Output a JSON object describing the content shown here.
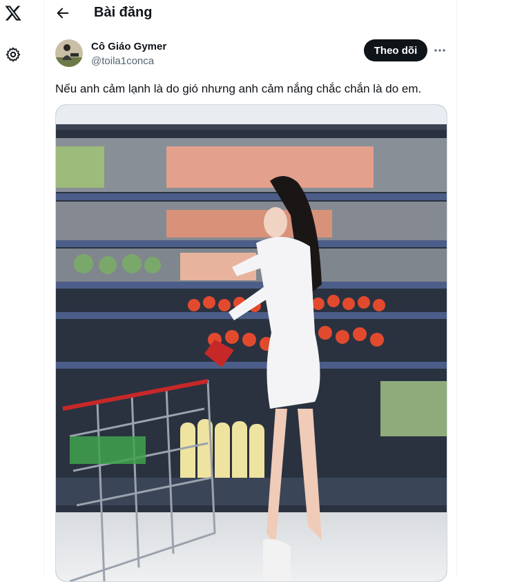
{
  "nav": {
    "logo_icon": "x-logo-icon",
    "settings_icon": "gear-icon"
  },
  "header": {
    "back_icon": "arrow-left-icon",
    "title": "Bài đăng"
  },
  "post": {
    "author_name": "Cô Giáo Gymer",
    "author_handle": "@toila1conca",
    "follow_label": "Theo dõi",
    "more_icon": "more-horizontal-icon",
    "text": "Nếu anh cảm lạnh là do gió nhưng anh cảm nắng chắc chắn là do em.",
    "media_alt": "supermarket-photo"
  },
  "colors": {
    "primary_text": "#0f1419",
    "secondary_text": "#536471",
    "border": "#cfd9de",
    "follow_bg": "#0f1419"
  }
}
